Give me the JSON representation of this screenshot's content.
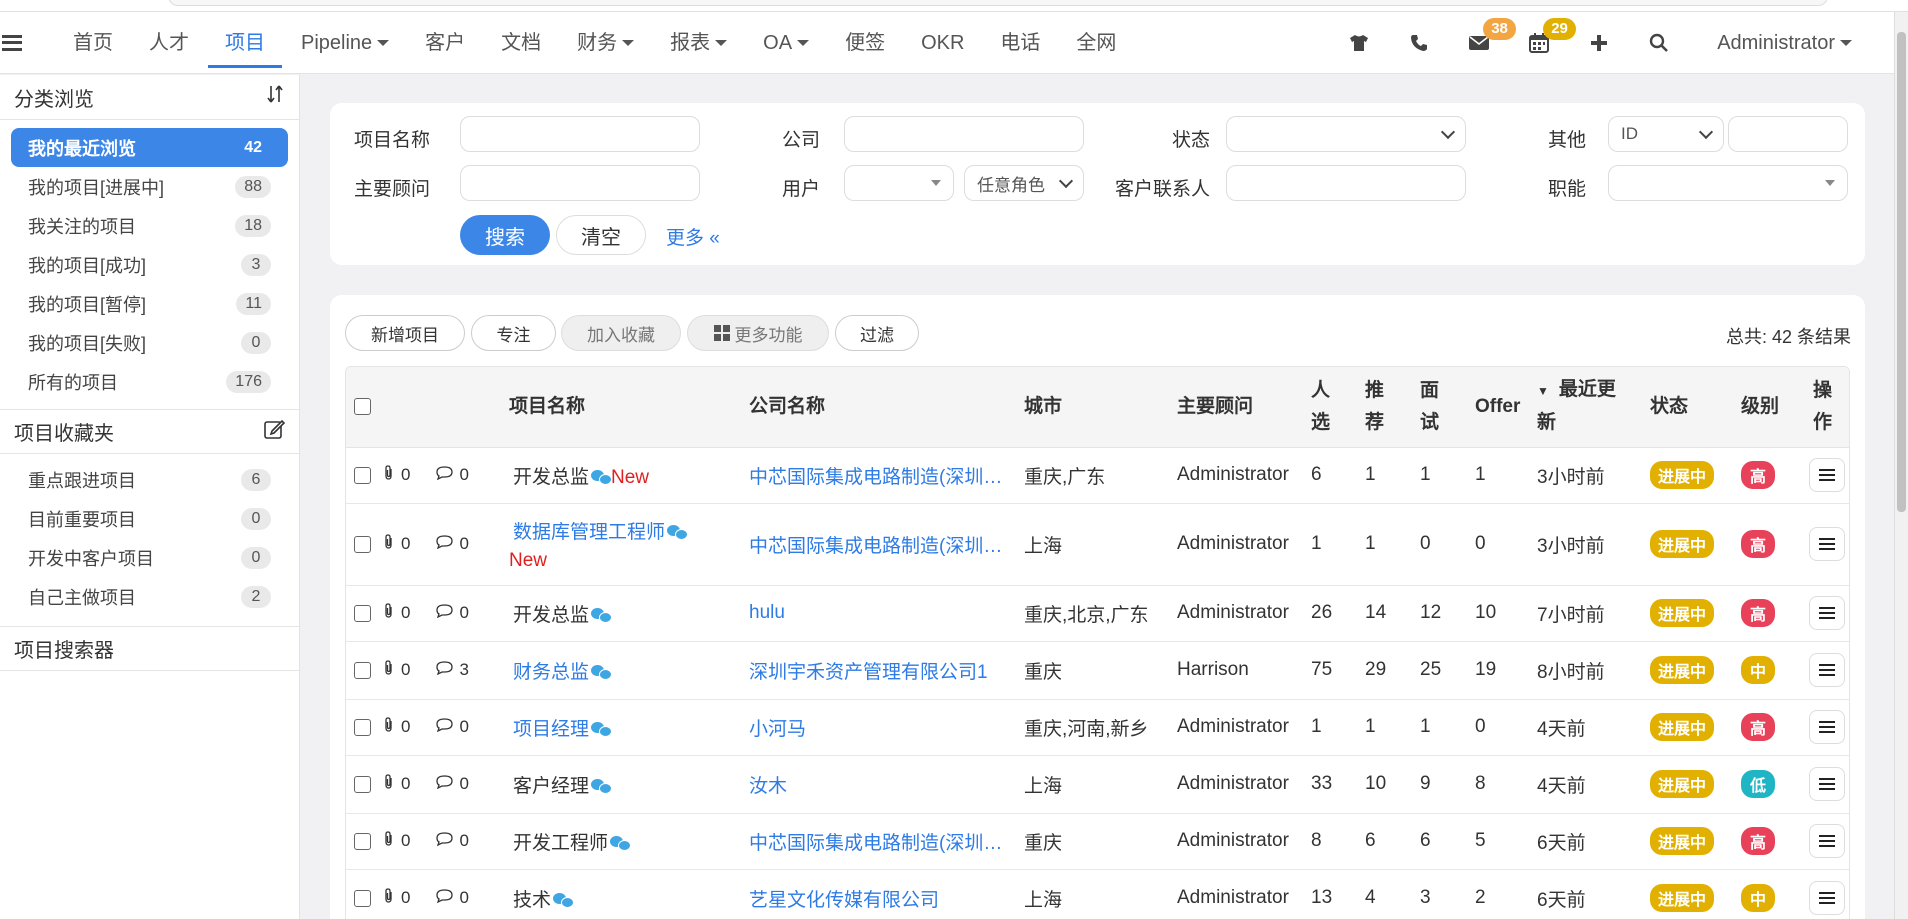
{
  "nav": {
    "items": [
      "首页",
      "人才",
      "项目",
      "Pipeline",
      "客户",
      "文档",
      "财务",
      "报表",
      "OA",
      "便签",
      "OKR",
      "电话",
      "全网"
    ],
    "dropdown_items": [
      false,
      false,
      false,
      true,
      false,
      false,
      true,
      true,
      true,
      false,
      false,
      false,
      false
    ],
    "active_index": 2,
    "mail_badge": "38",
    "calendar_badge": "29",
    "mail_badge_color": "#f2a541",
    "calendar_badge_color": "#e2b000",
    "user": "Administrator",
    "icons": [
      "shirt-icon",
      "phone-icon",
      "mail-icon",
      "calendar-icon",
      "plus-icon",
      "search-icon"
    ]
  },
  "sidebar": {
    "browse_title": "分类浏览",
    "items": [
      {
        "label": "我的最近浏览",
        "count": "42",
        "active": true
      },
      {
        "label": "我的项目[进展中]",
        "count": "88"
      },
      {
        "label": "我关注的项目",
        "count": "18"
      },
      {
        "label": "我的项目[成功]",
        "count": "3"
      },
      {
        "label": "我的项目[暂停]",
        "count": "11"
      },
      {
        "label": "我的项目[失败]",
        "count": "0"
      },
      {
        "label": "所有的项目",
        "count": "176"
      }
    ],
    "favorites_title": "项目收藏夹",
    "favorites": [
      {
        "label": "重点跟进项目",
        "count": "6"
      },
      {
        "label": "目前重要项目",
        "count": "0"
      },
      {
        "label": "开发中客户项目",
        "count": "0"
      },
      {
        "label": "自己主做项目",
        "count": "2"
      }
    ],
    "search_title": "项目搜索器"
  },
  "search": {
    "project_name_label": "项目名称",
    "company_label": "公司",
    "status_label": "状态",
    "other_label": "其他",
    "other_select_value": "ID",
    "main_consultant_label": "主要顾问",
    "user_label": "用户",
    "role_select_value": "任意角色",
    "client_contact_label": "客户联系人",
    "function_label": "职能",
    "search_button": "搜索",
    "clear_button": "清空",
    "more_link": "更多 «"
  },
  "toolbar": {
    "add_project": "新增项目",
    "focus": "专注",
    "add_favorite": "加入收藏",
    "more_functions": "更多功能",
    "filter": "过滤",
    "total": "总共: 42 条结果"
  },
  "table": {
    "headers": {
      "project_name": "项目名称",
      "company": "公司名称",
      "city": "城市",
      "consultant": "主要顾问",
      "candidates": "人选",
      "recommend": "推荐",
      "interview": "面试",
      "offer": "Offer",
      "updated": "最近更新",
      "status": "状态",
      "level": "级别",
      "action": "操作"
    },
    "rows": [
      {
        "attach": "0",
        "comments": "0",
        "project": "开发总监",
        "project_link": false,
        "new": "New",
        "company": "中芯国际集成电路制造(深圳)有限公司",
        "city": "重庆,广东",
        "consultant": "Administrator",
        "candidates": "6",
        "recommend": "1",
        "interview": "1",
        "offer": "1",
        "updated": "3小时前",
        "status": "进展中",
        "level": "高",
        "level_color": "#e8415a"
      },
      {
        "attach": "0",
        "comments": "0",
        "project": "数据库管理工程师",
        "project_link": true,
        "new": "New",
        "company": "中芯国际集成电路制造(深圳)有限公司",
        "city": "上海",
        "consultant": "Administrator",
        "candidates": "1",
        "recommend": "1",
        "interview": "0",
        "offer": "0",
        "updated": "3小时前",
        "status": "进展中",
        "level": "高",
        "level_color": "#e8415a"
      },
      {
        "attach": "0",
        "comments": "0",
        "project": "开发总监",
        "project_link": false,
        "new": "",
        "company": "hulu",
        "city": "重庆,北京,广东",
        "consultant": "Administrator",
        "candidates": "26",
        "recommend": "14",
        "interview": "12",
        "offer": "10",
        "updated": "7小时前",
        "status": "进展中",
        "level": "高",
        "level_color": "#e8415a"
      },
      {
        "attach": "0",
        "comments": "3",
        "project": "财务总监",
        "project_link": true,
        "new": "",
        "company": "深圳宇禾资产管理有限公司1",
        "city": "重庆",
        "consultant": "Harrison",
        "candidates": "75",
        "recommend": "29",
        "interview": "25",
        "offer": "19",
        "updated": "8小时前",
        "status": "进展中",
        "level": "中",
        "level_color": "#e2b000"
      },
      {
        "attach": "0",
        "comments": "0",
        "project": "项目经理",
        "project_link": true,
        "new": "",
        "company": "小河马",
        "city": "重庆,河南,新乡",
        "consultant": "Administrator",
        "candidates": "1",
        "recommend": "1",
        "interview": "1",
        "offer": "0",
        "updated": "4天前",
        "status": "进展中",
        "level": "高",
        "level_color": "#e8415a"
      },
      {
        "attach": "0",
        "comments": "0",
        "project": "客户经理",
        "project_link": false,
        "new": "",
        "company": "汝木",
        "city": "上海",
        "consultant": "Administrator",
        "candidates": "33",
        "recommend": "10",
        "interview": "9",
        "offer": "8",
        "updated": "4天前",
        "status": "进展中",
        "level": "低",
        "level_color": "#1fb5c4"
      },
      {
        "attach": "0",
        "comments": "0",
        "project": "开发工程师",
        "project_link": false,
        "new": "",
        "company": "中芯国际集成电路制造(深圳)有限公司",
        "city": "重庆",
        "consultant": "Administrator",
        "candidates": "8",
        "recommend": "6",
        "interview": "6",
        "offer": "5",
        "updated": "6天前",
        "status": "进展中",
        "level": "高",
        "level_color": "#e8415a"
      },
      {
        "attach": "0",
        "comments": "0",
        "project": "技术",
        "project_link": false,
        "new": "",
        "company": "艺星文化传媒有限公司",
        "city": "上海",
        "consultant": "Administrator",
        "candidates": "13",
        "recommend": "4",
        "interview": "3",
        "offer": "2",
        "updated": "6天前",
        "status": "进展中",
        "level": "中",
        "level_color": "#e2b000"
      }
    ]
  }
}
